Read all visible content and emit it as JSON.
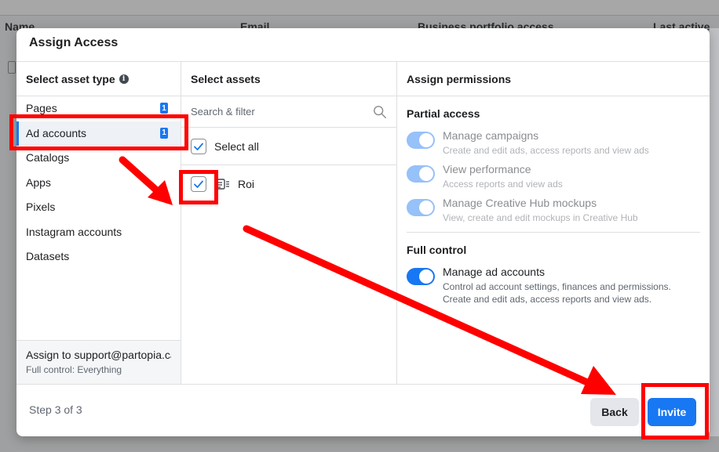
{
  "background": {
    "columns": [
      "Name",
      "Email",
      "Business portfolio access",
      "Last active"
    ]
  },
  "dialog": {
    "title": "Assign Access",
    "left_panel": {
      "header": "Select asset type",
      "items": [
        {
          "label": "Pages",
          "count": "1"
        },
        {
          "label": "Ad accounts",
          "count": "1"
        },
        {
          "label": "Catalogs"
        },
        {
          "label": "Apps"
        },
        {
          "label": "Pixels"
        },
        {
          "label": "Instagram accounts"
        },
        {
          "label": "Datasets"
        }
      ],
      "assign_to": "Assign to support@partopia.ca",
      "assign_summary": "Full control: Everything"
    },
    "middle_panel": {
      "header": "Select assets",
      "search_placeholder": "Search & filter",
      "select_all": "Select all",
      "assets": [
        {
          "label": "Roi",
          "checked": true
        }
      ]
    },
    "right_panel": {
      "header": "Assign permissions",
      "partial_title": "Partial access",
      "partial": [
        {
          "title": "Manage campaigns",
          "desc": "Create and edit ads, access reports and view ads"
        },
        {
          "title": "View performance",
          "desc": "Access reports and view ads"
        },
        {
          "title": "Manage Creative Hub mockups",
          "desc": "View, create and edit mockups in Creative Hub"
        }
      ],
      "full_title": "Full control",
      "full": {
        "title": "Manage ad accounts",
        "desc": "Control ad account settings, finances and permissions. Create and edit ads, access reports and view ads."
      }
    },
    "footer": {
      "step": "Step 3 of 3",
      "back_label": "Back",
      "invite_label": "Invite"
    }
  },
  "colors": {
    "accent": "#1877f2",
    "annotation": "#ff0000"
  }
}
